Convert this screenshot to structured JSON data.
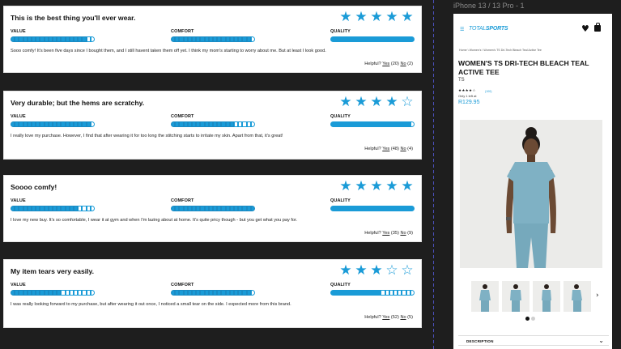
{
  "reviews": [
    {
      "title": "This is the best thing you'll ever wear.",
      "stars": 5,
      "value": 0.9,
      "comfort": 0.95,
      "quality": 1.0,
      "body": "Sooo comfy! It's been five days since I bought them, and I still havent taken them off yet. I think my mom's starting to worry about me. But at least I look good.",
      "helpful_prefix": "Helpful?",
      "yes": "Yes",
      "yes_count": "(20)",
      "no": "No",
      "no_count": "(2)"
    },
    {
      "title": "Very durable; but the hems are scratchy.",
      "stars": 4,
      "value": 0.95,
      "comfort": 0.75,
      "quality": 0.95,
      "body": "I really love my purchase. However, I find that after wearing it for too long the stitching starts to irritate my skin. Apart from that, it's great!",
      "helpful_prefix": "Helpful?",
      "yes": "Yes",
      "yes_count": "(48)",
      "no": "No",
      "no_count": "(4)"
    },
    {
      "title": "Soooo comfy!",
      "stars": 5,
      "value": 0.8,
      "comfort": 1.0,
      "quality": 1.0,
      "body": "I love my new buy. It's so comfortable, I wear it at gym and when I'm lazing about at home. It's quite pricy though - but you get what you pay for.",
      "helpful_prefix": "Helpful?",
      "yes": "Yes",
      "yes_count": "(35)",
      "no": "No",
      "no_count": "(9)"
    },
    {
      "title": "My item tears very easily.",
      "stars": 3,
      "value": 0.6,
      "comfort": 0.95,
      "quality": 0.6,
      "body": "I was really looking forward to my purchase, but after wearing it out once, I noticed a small tear on the side. I expected more from this brand.",
      "helpful_prefix": "Helpful?",
      "yes": "Yes",
      "yes_count": "(52)",
      "no": "No",
      "no_count": "(5)"
    }
  ],
  "labels": {
    "value": "VALUE",
    "comfort": "COMFORT",
    "quality": "QUALITY"
  },
  "frame_label": "iPhone 13 / 13 Pro - 1",
  "phone": {
    "logo_prefix": "TOTAL",
    "logo_suffix": "SPORTS",
    "breadcrumb": "Home \\ Women's \\ Women's TS Dri-Tech Bleach Teal Active Tee",
    "product_title": "WOMEN'S TS DRI-TECH BLEACH TEAL ACTIVE TEE",
    "brand": "TS",
    "rating_stars": "★★★★☆",
    "review_count": "(100)",
    "stock": "Only 1 left at",
    "price": "R129.95",
    "description_label": "DESCRIPTION"
  },
  "colors": {
    "accent": "#1a9bd7",
    "background": "#1e1e1e"
  },
  "icons": [
    "star-icon",
    "menu-icon",
    "heart-icon",
    "bag-icon",
    "chevron-right-icon",
    "chevron-down-icon"
  ]
}
